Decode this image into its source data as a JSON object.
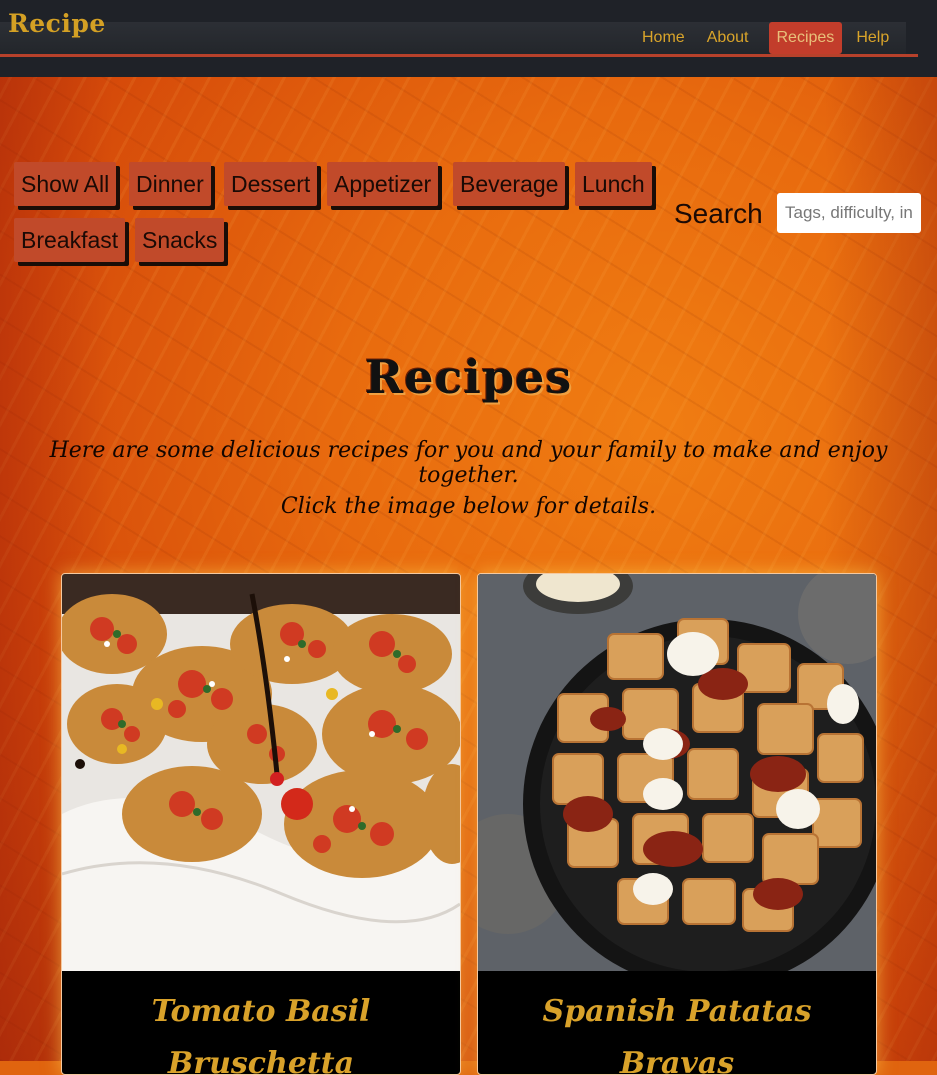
{
  "nav": {
    "brand": "Recipe",
    "links": [
      {
        "label": "Home",
        "active": false
      },
      {
        "label": "About",
        "active": false
      },
      {
        "label": "Recipes",
        "active": true
      },
      {
        "label": "Help",
        "active": false
      }
    ]
  },
  "filters": [
    "Show All",
    "Dinner",
    "Dessert",
    "Appetizer",
    "Beverage",
    "Lunch",
    "Breakfast",
    "Snacks"
  ],
  "search": {
    "label": "Search",
    "placeholder": "Tags, difficulty, ingredients"
  },
  "main": {
    "title": "Recipes",
    "intro_line1": "Here are some delicious recipes for you and your family to make and enjoy together.",
    "intro_line2": "Click the image below for details."
  },
  "cards": [
    {
      "title_line1": "Tomato Basil",
      "title_line2": "Bruschetta"
    },
    {
      "title_line1": "Spanish Patatas",
      "title_line2": "Bravas"
    }
  ],
  "colors": {
    "nav_bg": "#1f2228",
    "brand": "#d4a024",
    "accent": "#c23d2b",
    "chip": "#c14a2a",
    "card_title": "#d9a22a"
  }
}
